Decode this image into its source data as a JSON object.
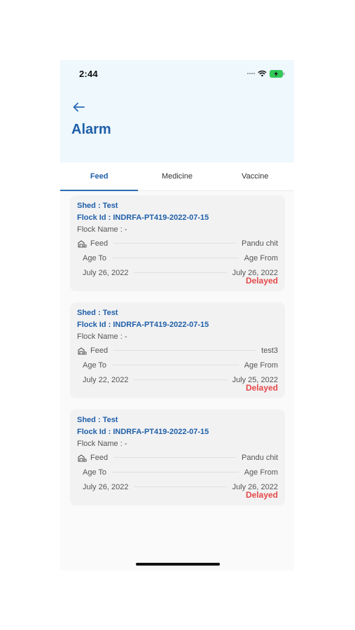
{
  "status_bar": {
    "time": "2:44"
  },
  "header": {
    "title": "Alarm"
  },
  "tabs": [
    {
      "label": "Feed",
      "active": true
    },
    {
      "label": "Medicine",
      "active": false
    },
    {
      "label": "Vaccine",
      "active": false
    }
  ],
  "cards": [
    {
      "shed": "Shed : Test",
      "flock_id": "Flock Id : INDRFA-PT419-2022-07-15",
      "flock_name": "Flock Name : -",
      "feed_label": "Feed",
      "feed_value": "Pandu chit",
      "age_to_label": "Age To",
      "age_from_label": "Age From",
      "date_left": "July 26, 2022",
      "date_right": "July 26, 2022",
      "status": "Delayed"
    },
    {
      "shed": "Shed : Test",
      "flock_id": "Flock Id : INDRFA-PT419-2022-07-15",
      "flock_name": "Flock Name : -",
      "feed_label": "Feed",
      "feed_value": "test3",
      "age_to_label": "Age To",
      "age_from_label": "Age From",
      "date_left": "July 22, 2022",
      "date_right": "July 25, 2022",
      "status": "Delayed"
    },
    {
      "shed": "Shed : Test",
      "flock_id": "Flock Id : INDRFA-PT419-2022-07-15",
      "flock_name": "Flock Name : -",
      "feed_label": "Feed",
      "feed_value": "Pandu chit",
      "age_to_label": "Age To",
      "age_from_label": "Age From",
      "date_left": "July 26, 2022",
      "date_right": "July 26, 2022",
      "status": "Delayed"
    }
  ],
  "colors": {
    "header_bg": "#eef8fd",
    "accent": "#1f5fa8",
    "delayed": "#e54848",
    "battery": "#34c759"
  },
  "icons": [
    "back-arrow-icon",
    "signal-icon",
    "wifi-icon",
    "battery-charging-icon",
    "feed-icon"
  ]
}
